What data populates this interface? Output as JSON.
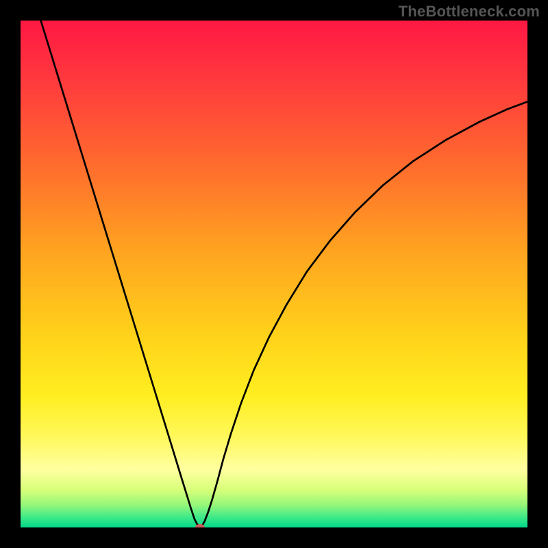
{
  "watermark": "TheBottleneck.com",
  "chart_data": {
    "type": "line",
    "title": "",
    "xlabel": "",
    "ylabel": "",
    "xlim": [
      0,
      1
    ],
    "ylim": [
      0,
      1
    ],
    "background_gradient": {
      "stops": [
        {
          "offset": 0.0,
          "color": "#ff1843"
        },
        {
          "offset": 0.12,
          "color": "#ff3a3d"
        },
        {
          "offset": 0.28,
          "color": "#ff6a2e"
        },
        {
          "offset": 0.45,
          "color": "#ffa220"
        },
        {
          "offset": 0.62,
          "color": "#ffd21a"
        },
        {
          "offset": 0.74,
          "color": "#ffee20"
        },
        {
          "offset": 0.82,
          "color": "#fff85a"
        },
        {
          "offset": 0.885,
          "color": "#ffffa0"
        },
        {
          "offset": 0.925,
          "color": "#d9ff7a"
        },
        {
          "offset": 0.955,
          "color": "#97f778"
        },
        {
          "offset": 0.978,
          "color": "#44eb88"
        },
        {
          "offset": 1.0,
          "color": "#00d98a"
        }
      ]
    },
    "series": [
      {
        "name": "curve",
        "color": "#000000",
        "width": 2.7,
        "points": [
          {
            "x": 0.04,
            "y": 1.0
          },
          {
            "x": 0.06,
            "y": 0.935
          },
          {
            "x": 0.08,
            "y": 0.87
          },
          {
            "x": 0.1,
            "y": 0.805
          },
          {
            "x": 0.12,
            "y": 0.74
          },
          {
            "x": 0.14,
            "y": 0.675
          },
          {
            "x": 0.16,
            "y": 0.61
          },
          {
            "x": 0.18,
            "y": 0.545
          },
          {
            "x": 0.2,
            "y": 0.48
          },
          {
            "x": 0.22,
            "y": 0.415
          },
          {
            "x": 0.24,
            "y": 0.35
          },
          {
            "x": 0.26,
            "y": 0.285
          },
          {
            "x": 0.28,
            "y": 0.22
          },
          {
            "x": 0.3,
            "y": 0.155
          },
          {
            "x": 0.315,
            "y": 0.106
          },
          {
            "x": 0.328,
            "y": 0.064
          },
          {
            "x": 0.336,
            "y": 0.038
          },
          {
            "x": 0.343,
            "y": 0.017
          },
          {
            "x": 0.348,
            "y": 0.007
          },
          {
            "x": 0.352,
            "y": 0.002
          },
          {
            "x": 0.354,
            "y": 0.0
          },
          {
            "x": 0.358,
            "y": 0.003
          },
          {
            "x": 0.363,
            "y": 0.012
          },
          {
            "x": 0.37,
            "y": 0.03
          },
          {
            "x": 0.378,
            "y": 0.055
          },
          {
            "x": 0.388,
            "y": 0.09
          },
          {
            "x": 0.4,
            "y": 0.135
          },
          {
            "x": 0.415,
            "y": 0.185
          },
          {
            "x": 0.435,
            "y": 0.245
          },
          {
            "x": 0.46,
            "y": 0.31
          },
          {
            "x": 0.49,
            "y": 0.375
          },
          {
            "x": 0.525,
            "y": 0.44
          },
          {
            "x": 0.565,
            "y": 0.505
          },
          {
            "x": 0.61,
            "y": 0.565
          },
          {
            "x": 0.66,
            "y": 0.622
          },
          {
            "x": 0.715,
            "y": 0.675
          },
          {
            "x": 0.775,
            "y": 0.723
          },
          {
            "x": 0.84,
            "y": 0.765
          },
          {
            "x": 0.905,
            "y": 0.8
          },
          {
            "x": 0.96,
            "y": 0.825
          },
          {
            "x": 1.0,
            "y": 0.84
          }
        ]
      }
    ],
    "markers": [
      {
        "name": "min-marker",
        "x": 0.354,
        "y": 0.0,
        "rx": 7,
        "ry": 5,
        "fill": "#cd5c5c"
      }
    ]
  }
}
